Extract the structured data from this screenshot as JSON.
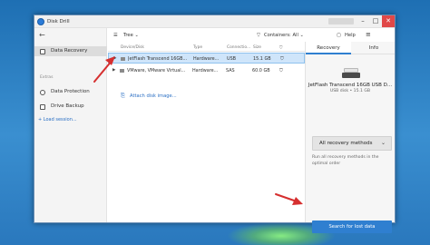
{
  "window": {
    "title": "Disk Drill",
    "user_badge": "",
    "min_glyph": "–",
    "max_glyph": "□",
    "close_glyph": "✕"
  },
  "sidebar": {
    "back_glyph": "←",
    "items": [
      {
        "label": "Data Recovery",
        "icon": "data-recovery-icon"
      },
      {
        "label": "Data Protection",
        "icon": "shield-icon"
      },
      {
        "label": "Drive Backup",
        "icon": "backup-icon"
      }
    ],
    "extras_label": "Extras",
    "load_session": "+ Load session..."
  },
  "toolbar": {
    "view_label": "Tree",
    "view_icon": "list-icon",
    "filter_label": "Containers: All",
    "filter_icon": "filter-icon",
    "help_label": "Help",
    "menu_glyph": "≡"
  },
  "table": {
    "columns": [
      "Device/Disk",
      "Type",
      "Connectio...",
      "Size"
    ],
    "rows": [
      {
        "name": "JetFlash Transcend 16GB...",
        "type": "Hardware...",
        "connection": "USB",
        "size": "15.1 GB",
        "selected": true
      },
      {
        "name": "VMware, VMware Virtual...",
        "type": "Hardware...",
        "connection": "SAS",
        "size": "60.0 GB",
        "selected": false
      }
    ],
    "attach_label": "Attach disk image..."
  },
  "right_panel": {
    "tabs": [
      "Recovery",
      "Info"
    ],
    "active_tab": 0,
    "disk_name": "JetFlash Transcend 16GB USB D...",
    "disk_size": "USB disk • 15.1 GB",
    "method_label": "All recovery methods",
    "method_desc": "Run all recovery methods in the optimal order",
    "search_button": "Search for lost data"
  },
  "colors": {
    "accent": "#2f7fd0",
    "selection": "#cfe5fa",
    "arrow": "#d62f2f",
    "desktop": "#2a78bd"
  }
}
